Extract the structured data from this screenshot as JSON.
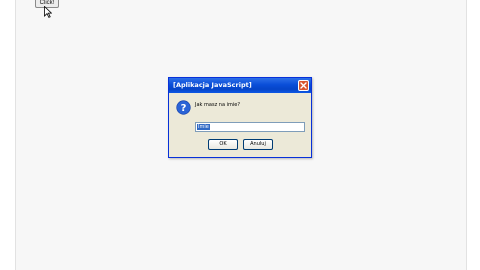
{
  "page": {
    "button_label": "Click!"
  },
  "dialog": {
    "title": "[Aplikacja JavaScript]",
    "icon": "question-icon",
    "prompt": "Jak masz na imie?",
    "input_value": "Imie",
    "ok_label": "OK",
    "cancel_label": "Anuluj"
  },
  "colors": {
    "titlebar": "#0a4ed8",
    "dialog_bg": "#ece9d8",
    "close_button": "#d9562f",
    "selection": "#316ac5"
  }
}
